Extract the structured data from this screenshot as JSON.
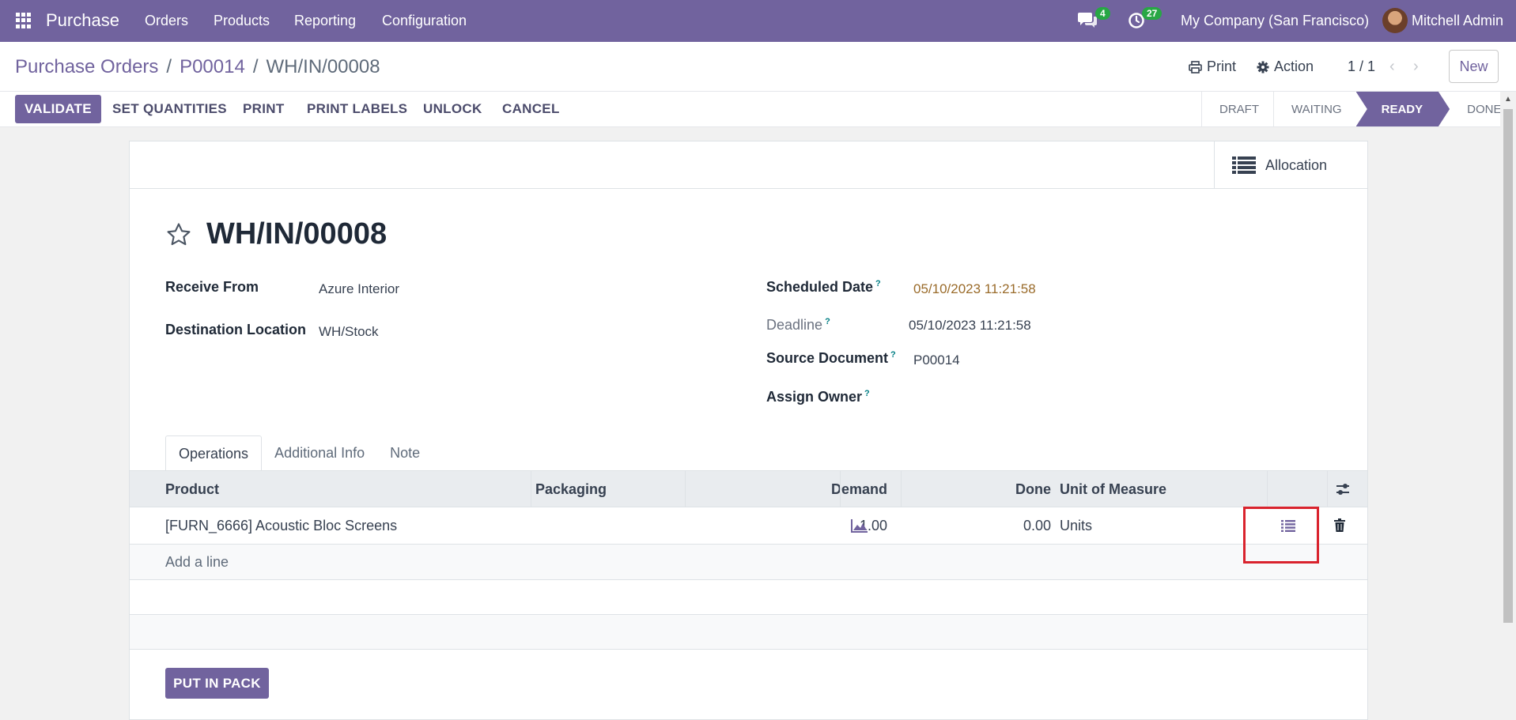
{
  "topnav": {
    "app_name": "Purchase",
    "menu": [
      "Orders",
      "Products",
      "Reporting",
      "Configuration"
    ],
    "messages_count": "4",
    "activities_count": "27",
    "company": "My Company (San Francisco)",
    "user": "Mitchell Admin"
  },
  "control": {
    "breadcrumb": [
      "Purchase Orders",
      "P00014",
      "WH/IN/00008"
    ],
    "separator": "/",
    "print_label": "Print",
    "action_label": "Action",
    "pager": "1 / 1",
    "new_label": "New"
  },
  "statusbar": {
    "buttons": [
      "VALIDATE",
      "SET QUANTITIES",
      "PRINT",
      "PRINT LABELS",
      "UNLOCK",
      "CANCEL"
    ],
    "stages": [
      "DRAFT",
      "WAITING",
      "READY",
      "DONE"
    ],
    "active_stage": "READY"
  },
  "sheet": {
    "allocation_label": "Allocation",
    "title": "WH/IN/00008",
    "fields": {
      "receive_from_label": "Receive From",
      "receive_from_value": "Azure Interior",
      "destination_label": "Destination Location",
      "destination_value": "WH/Stock",
      "scheduled_label": "Scheduled Date",
      "scheduled_value": "05/10/2023 11:21:58",
      "deadline_label": "Deadline",
      "deadline_value": "05/10/2023 11:21:58",
      "source_label": "Source Document",
      "source_value": "P00014",
      "owner_label": "Assign Owner",
      "help_mark": "?"
    },
    "tabs": [
      "Operations",
      "Additional Info",
      "Note"
    ],
    "table": {
      "headers": {
        "product": "Product",
        "packaging": "Packaging",
        "demand": "Demand",
        "done": "Done",
        "uom": "Unit of Measure"
      },
      "rows": [
        {
          "product": "[FURN_6666] Acoustic Bloc Screens",
          "packaging": "",
          "demand": "1.00",
          "done": "0.00",
          "uom": "Units"
        }
      ],
      "add_line": "Add a line"
    },
    "put_in_pack_label": "PUT IN PACK"
  },
  "colors": {
    "brand": "#71639e",
    "highlight": "#d9232d",
    "badge": "#28a745"
  }
}
